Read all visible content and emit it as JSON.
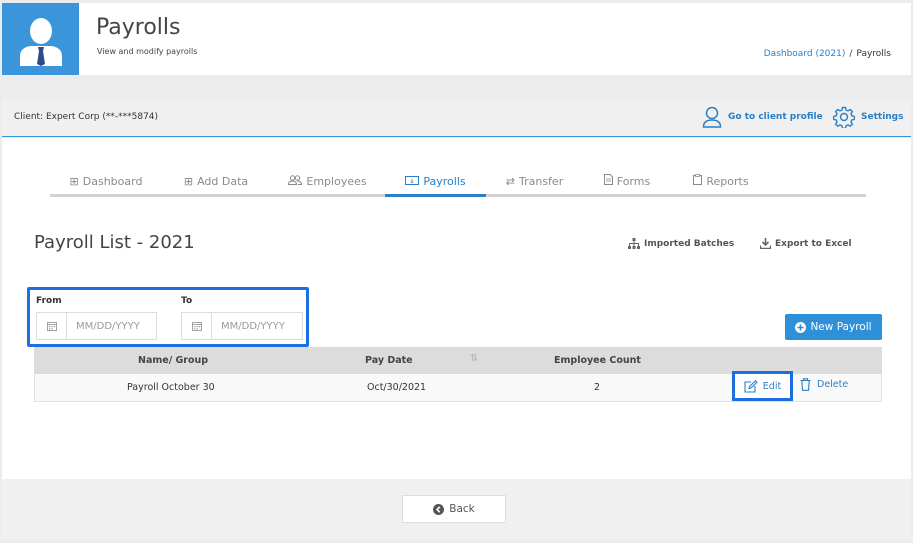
{
  "header": {
    "title": "Payrolls",
    "subtitle": "View and modify payrolls",
    "breadcrumb": {
      "link": "Dashboard (2021)",
      "separator": "/",
      "current": "Payrolls"
    }
  },
  "client_bar": {
    "client_label": "Client: Expert Corp (**-***5874)",
    "profile_link": "Go to client profile",
    "settings_link": "Settings"
  },
  "tabs": [
    {
      "label": "Dashboard",
      "icon": "grid-icon"
    },
    {
      "label": "Add Data",
      "icon": "plus-box-icon"
    },
    {
      "label": "Employees",
      "icon": "users-icon"
    },
    {
      "label": "Payrolls",
      "icon": "money-icon",
      "active": true
    },
    {
      "label": "Transfer",
      "icon": "transfer-icon"
    },
    {
      "label": "Forms",
      "icon": "file-icon"
    },
    {
      "label": "Reports",
      "icon": "clipboard-icon"
    }
  ],
  "list": {
    "title": "Payroll List - 2021",
    "imported_batches": "Imported Batches",
    "export_excel": "Export to Excel"
  },
  "filter": {
    "from_label": "From",
    "to_label": "To",
    "from_placeholder": "MM/DD/YYYY",
    "to_placeholder": "MM/DD/YYYY"
  },
  "new_payroll": "New Payroll",
  "table": {
    "columns": [
      "Name/ Group",
      "Pay Date",
      "Employee Count"
    ],
    "rows": [
      {
        "name": "Payroll October 30",
        "pay_date": "Oct/30/2021",
        "count": "2",
        "edit": "Edit",
        "delete": "Delete"
      }
    ]
  },
  "footer": {
    "back": "Back"
  },
  "colors": {
    "accent": "#2e90d8",
    "highlight": "#1c6fe0"
  }
}
